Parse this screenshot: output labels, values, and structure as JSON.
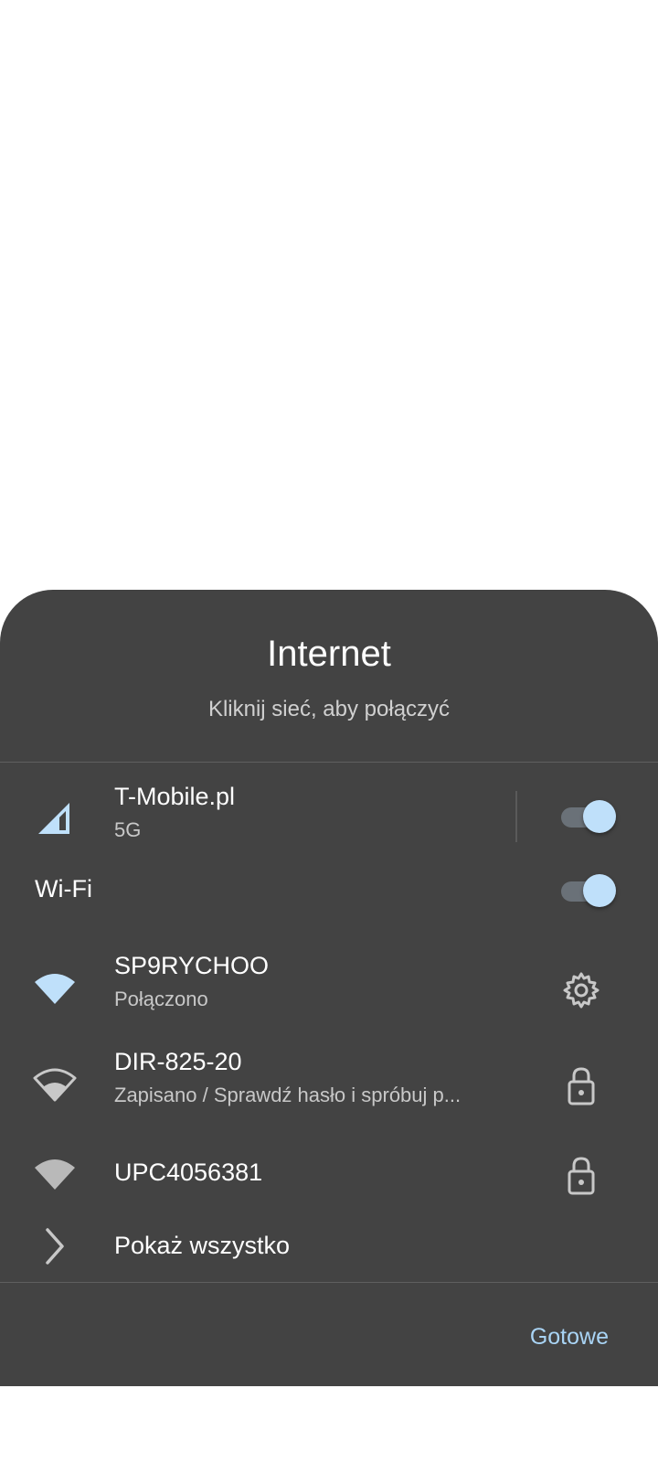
{
  "dialog": {
    "title": "Internet",
    "subtitle": "Kliknij sieć, aby połączyć"
  },
  "mobile": {
    "name": "T-Mobile.pl",
    "type": "5G",
    "enabled": true,
    "icon": "cellular-signal-icon"
  },
  "wifi": {
    "label": "Wi-Fi",
    "enabled": true
  },
  "networks": [
    {
      "name": "SP9RYCHOO",
      "status": "Połączono",
      "action_icon": "gear-icon",
      "signal_icon": "wifi-full-icon"
    },
    {
      "name": "DIR-825-20",
      "status": "Zapisano / Sprawdź hasło i spróbuj p...",
      "action_icon": "lock-icon",
      "signal_icon": "wifi-medium-icon"
    },
    {
      "name": "UPC4056381",
      "status": "",
      "action_icon": "lock-icon",
      "signal_icon": "wifi-full-gray-icon"
    }
  ],
  "show_all": {
    "label": "Pokaż wszystko",
    "icon": "chevron-right-icon"
  },
  "footer": {
    "done_label": "Gotowe"
  },
  "colors": {
    "sheet_bg": "#434343",
    "accent": "#a9d4f5",
    "toggle_thumb": "#bfe0fa"
  }
}
